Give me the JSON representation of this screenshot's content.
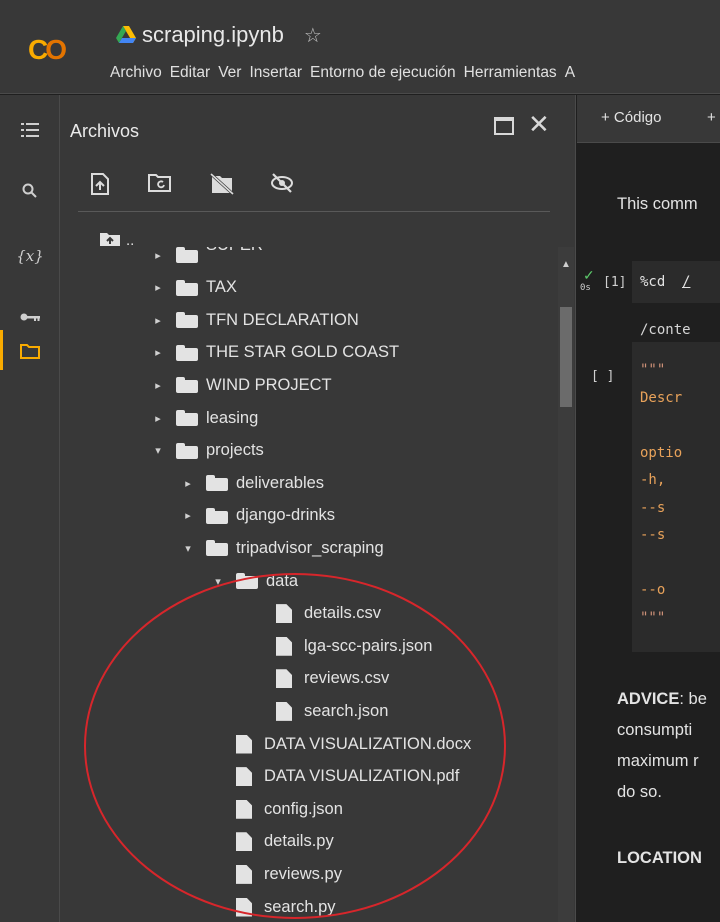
{
  "app": {
    "logo_text": "CO",
    "title": "scraping.ipynb",
    "star": "☆"
  },
  "menu": [
    "Archivo",
    "Editar",
    "Ver",
    "Insertar",
    "Entorno de ejecución",
    "Herramientas",
    "A"
  ],
  "panel": {
    "title": "Archivos",
    "close": "✕",
    "up_label": ".."
  },
  "tree": [
    {
      "label": "SUPER",
      "type": "folder",
      "caret": "▸",
      "level": 0,
      "partial": true
    },
    {
      "label": "TAX",
      "type": "folder",
      "caret": "▸",
      "level": 0
    },
    {
      "label": "TFN DECLARATION",
      "type": "folder",
      "caret": "▸",
      "level": 0
    },
    {
      "label": "THE STAR GOLD COAST",
      "type": "folder",
      "caret": "▸",
      "level": 0
    },
    {
      "label": "WIND PROJECT",
      "type": "folder",
      "caret": "▸",
      "level": 0
    },
    {
      "label": "leasing",
      "type": "folder",
      "caret": "▸",
      "level": 0
    },
    {
      "label": "projects",
      "type": "folder",
      "caret": "▾",
      "level": 0
    },
    {
      "label": "deliverables",
      "type": "folder",
      "caret": "▸",
      "level": 1
    },
    {
      "label": "django-drinks",
      "type": "folder",
      "caret": "▸",
      "level": 1
    },
    {
      "label": "tripadvisor_scraping",
      "type": "folder",
      "caret": "▾",
      "level": 1
    },
    {
      "label": "data",
      "type": "folder",
      "caret": "▾",
      "level": 2
    },
    {
      "label": "details.csv",
      "type": "file",
      "level": 3
    },
    {
      "label": "lga-scc-pairs.json",
      "type": "file",
      "level": 3
    },
    {
      "label": "reviews.csv",
      "type": "file",
      "level": 3
    },
    {
      "label": "search.json",
      "type": "file",
      "level": 3
    },
    {
      "label": "DATA VISUALIZATION.docx",
      "type": "file",
      "level": 2
    },
    {
      "label": "DATA VISUALIZATION.pdf",
      "type": "file",
      "level": 2
    },
    {
      "label": "config.json",
      "type": "file",
      "level": 2
    },
    {
      "label": "details.py",
      "type": "file",
      "level": 2
    },
    {
      "label": "reviews.py",
      "type": "file",
      "level": 2
    },
    {
      "label": "search.py",
      "type": "file",
      "level": 2
    }
  ],
  "notebook": {
    "add_code": "+ Código",
    "add_more": "+",
    "intro_text": "This comm",
    "cell1": {
      "prompt": "[1]",
      "code_cmd": "%cd",
      "code_arg": "/",
      "output": "/conte",
      "runtime": "0s"
    },
    "cell2": {
      "prompt": "[ ]",
      "lines": [
        "\"\"\"",
        "Descr",
        "",
        "optio",
        "  -h,",
        "  --s",
        "  --s",
        "",
        "  --o",
        "\"\"\""
      ]
    },
    "advice_bold": "ADVICE",
    "advice_rest": ": be",
    "para_lines": [
      "consumpti",
      "maximum r",
      "do so."
    ],
    "location": "LOCATION"
  },
  "colors": {
    "accent": "#f9ab00",
    "annotation": "#d7262b"
  }
}
